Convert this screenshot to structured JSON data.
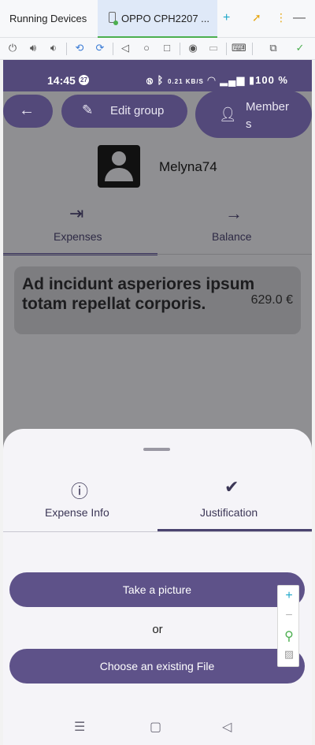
{
  "ide": {
    "title": "Running Devices",
    "device_tab": "OPPO CPH2207 ...",
    "icons": [
      "plus-icon",
      "arrow-icon",
      "more-icon",
      "minimize-icon"
    ]
  },
  "toolbar": {
    "icons": [
      "power-icon",
      "volume-up-icon",
      "volume-down-icon",
      "rotate-left-icon",
      "rotate-right-icon",
      "back-icon",
      "home-icon",
      "overview-icon",
      "screenshot-icon",
      "record-icon",
      "keyboard-icon",
      "inspect-icon",
      "check-icon"
    ]
  },
  "status_bar": {
    "time": "14:45",
    "notification_count": "27",
    "speed": "0.21 KB/S",
    "battery": "100 %"
  },
  "header": {
    "back_icon": "back-arrow-icon",
    "edit_group": "Edit group",
    "members": "Members"
  },
  "group": {
    "name": "Melyna74"
  },
  "tabs": {
    "expenses": "Expenses",
    "balance": "Balance"
  },
  "expense": {
    "title": "Ad incidunt asperiores ipsum totam repellat corporis.",
    "amount": "629.0 €"
  },
  "sheet": {
    "tab_info": "Expense Info",
    "tab_justification": "Justification",
    "take_picture": "Take a picture",
    "or": "or",
    "choose_file": "Choose an existing File"
  },
  "colors": {
    "primary": "#5e5289",
    "dark_primary": "#53497a"
  }
}
